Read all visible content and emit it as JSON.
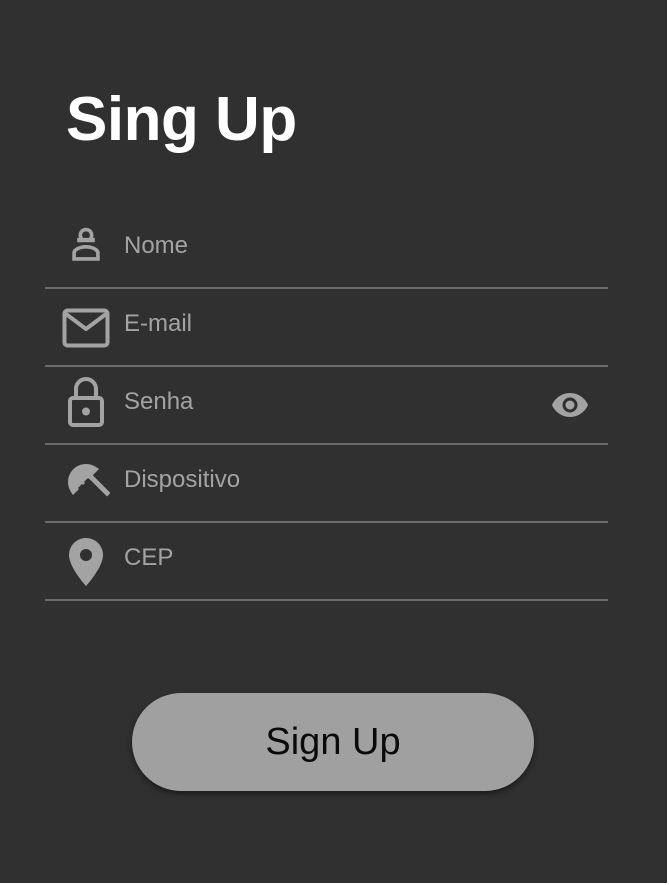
{
  "page": {
    "title": "Sing Up"
  },
  "form": {
    "fields": [
      {
        "label": "Nome",
        "icon": "person-icon"
      },
      {
        "label": "E-mail",
        "icon": "mail-icon"
      },
      {
        "label": "Senha",
        "icon": "lock-icon",
        "toggle_icon": "eye-icon"
      },
      {
        "label": "Dispositivo",
        "icon": "beach-umbrella-icon"
      },
      {
        "label": "CEP",
        "icon": "location-pin-icon"
      }
    ]
  },
  "actions": {
    "submit_label": "Sign Up"
  },
  "colors": {
    "background": "#303030",
    "title": "#ffffff",
    "field_text": "#a3a3a3",
    "divider": "#6b6b6b",
    "button_bg": "#a0a0a0",
    "button_text": "#0a0a0a"
  }
}
